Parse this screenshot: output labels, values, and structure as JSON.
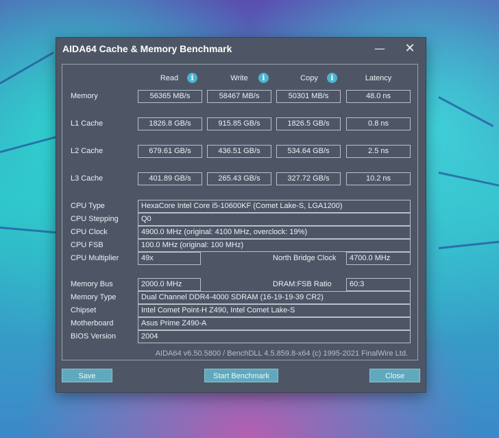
{
  "window": {
    "title": "AIDA64 Cache & Memory Benchmark",
    "minimize_glyph": "—",
    "close_glyph": "✕"
  },
  "columns": {
    "read": "Read",
    "write": "Write",
    "copy": "Copy",
    "latency": "Latency",
    "info_glyph": "i"
  },
  "rows": {
    "memory": {
      "label": "Memory",
      "read": "56365 MB/s",
      "write": "58467 MB/s",
      "copy": "50301 MB/s",
      "latency": "48.0 ns"
    },
    "l1": {
      "label": "L1 Cache",
      "read": "1826.8 GB/s",
      "write": "915.85 GB/s",
      "copy": "1826.5 GB/s",
      "latency": "0.8 ns"
    },
    "l2": {
      "label": "L2 Cache",
      "read": "679.61 GB/s",
      "write": "436.51 GB/s",
      "copy": "534.64 GB/s",
      "latency": "2.5 ns"
    },
    "l3": {
      "label": "L3 Cache",
      "read": "401.89 GB/s",
      "write": "265.43 GB/s",
      "copy": "327.72 GB/s",
      "latency": "10.2 ns"
    }
  },
  "info": {
    "cpu_type": {
      "label": "CPU Type",
      "value": "HexaCore Intel Core i5-10600KF  (Comet Lake-S, LGA1200)"
    },
    "cpu_stepping": {
      "label": "CPU Stepping",
      "value": "Q0"
    },
    "cpu_clock": {
      "label": "CPU Clock",
      "value": "4900.0 MHz  (original: 4100 MHz, overclock: 19%)"
    },
    "cpu_fsb": {
      "label": "CPU FSB",
      "value": "100.0 MHz  (original: 100 MHz)"
    },
    "cpu_multiplier": {
      "label": "CPU Multiplier",
      "value": "49x"
    },
    "nb_clock": {
      "label": "North Bridge Clock",
      "value": "4700.0 MHz"
    },
    "memory_bus": {
      "label": "Memory Bus",
      "value": "2000.0 MHz"
    },
    "dram_ratio": {
      "label": "DRAM:FSB Ratio",
      "value": "60:3"
    },
    "memory_type": {
      "label": "Memory Type",
      "value": "Dual Channel DDR4-4000 SDRAM  (16-19-19-39 CR2)"
    },
    "chipset": {
      "label": "Chipset",
      "value": "Intel Comet Point-H Z490, Intel Comet Lake-S"
    },
    "motherboard": {
      "label": "Motherboard",
      "value": "Asus Prime Z490-A"
    },
    "bios": {
      "label": "BIOS Version",
      "value": "2004"
    }
  },
  "footer": "AIDA64 v6.50.5800 / BenchDLL 4.5.859.8-x64  (c) 1995-2021 FinalWire Ltd.",
  "buttons": {
    "save": "Save",
    "start": "Start Benchmark",
    "close": "Close"
  },
  "colors": {
    "window_bg": "#4e5666",
    "button_bg": "#5fa9bd",
    "info_icon": "#4bb4cf"
  }
}
